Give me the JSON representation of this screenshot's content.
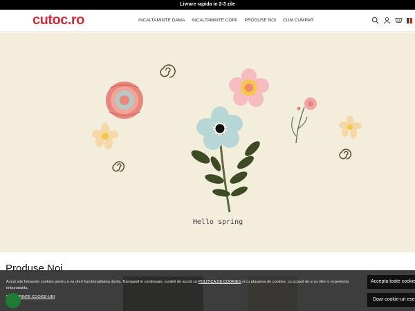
{
  "promo": {
    "text": "Livrare rapida in 2-3 zile"
  },
  "header": {
    "logo": "cutoc.ro",
    "nav": [
      {
        "label": "INCALTAMINTE DAMA"
      },
      {
        "label": "INCALTAMINTE COPII"
      },
      {
        "label": "PRODUSE NOI"
      },
      {
        "label": "CUM CUMPAR"
      }
    ],
    "icons": [
      "search-icon",
      "user-icon",
      "cart-icon",
      "flag-icon"
    ]
  },
  "hero": {
    "caption": "Hello spring"
  },
  "section": {
    "title": "Produse Noi"
  },
  "cookie": {
    "text_before": "Acest site foloseste cookies pentru a va oferi functionalitatea dorita. Navigand in continuare, sunteti de acord cu ",
    "policy_link": "POLITICA DE COOKIES",
    "text_after": " si cu plasarea de cookies, cu scopul de a va oferi o experienta imbunatatita.",
    "preferences": "PREFERINTE COOKIE-URI",
    "accept_all": "Accepta toate cookie-urile",
    "essential_only": "Doar cookie-uri esentiale"
  },
  "colors": {
    "brand": "#d02d3d",
    "hero_bg": "#f3eddc",
    "banner_bg": "#2d2d2d"
  }
}
